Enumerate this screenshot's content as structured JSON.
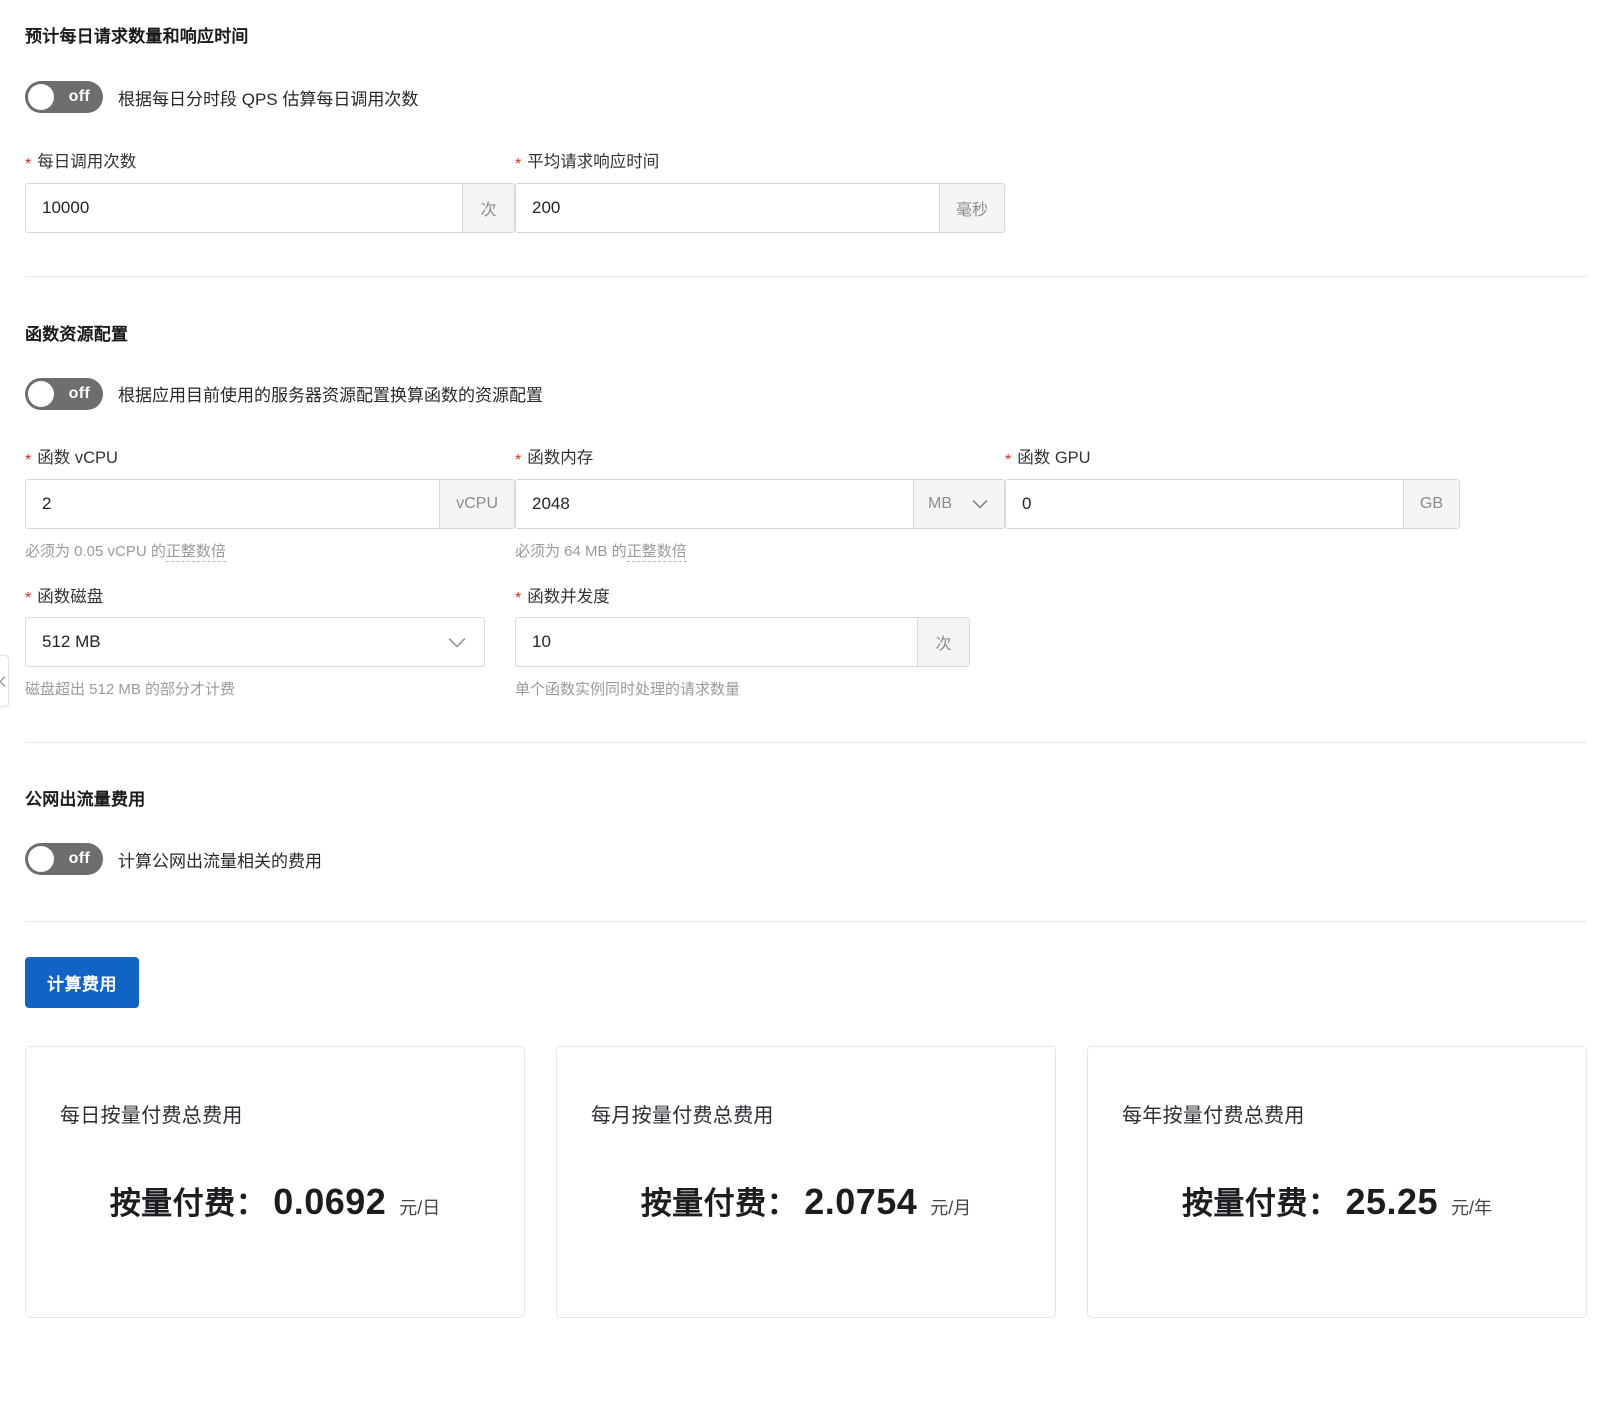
{
  "sections": {
    "requests": {
      "title": "预计每日请求数量和响应时间",
      "toggle": {
        "state": "off",
        "label": "根据每日分时段 QPS 估算每日调用次数"
      },
      "fields": {
        "daily_calls": {
          "label": "每日调用次数",
          "value": "10000",
          "suffix": "次"
        },
        "avg_response": {
          "label": "平均请求响应时间",
          "value": "200",
          "suffix": "毫秒"
        }
      }
    },
    "resources": {
      "title": "函数资源配置",
      "toggle": {
        "state": "off",
        "label": "根据应用目前使用的服务器资源配置换算函数的资源配置"
      },
      "fields": {
        "vcpu": {
          "label": "函数 vCPU",
          "value": "2",
          "suffix": "vCPU",
          "hint_prefix": "必须为 0.05 vCPU 的",
          "hint_link": "正整数倍"
        },
        "memory": {
          "label": "函数内存",
          "value": "2048",
          "suffix": "MB",
          "hint_prefix": "必须为 64 MB 的",
          "hint_link": "正整数倍"
        },
        "gpu": {
          "label": "函数 GPU",
          "value": "0",
          "suffix": "GB"
        },
        "disk": {
          "label": "函数磁盘",
          "value": "512 MB",
          "hint": "磁盘超出 512 MB 的部分才计费"
        },
        "concurrency": {
          "label": "函数并发度",
          "value": "10",
          "suffix": "次",
          "hint": "单个函数实例同时处理的请求数量"
        }
      }
    },
    "traffic": {
      "title": "公网出流量费用",
      "toggle": {
        "state": "off",
        "label": "计算公网出流量相关的费用"
      }
    }
  },
  "actions": {
    "calculate": "计算费用"
  },
  "results": [
    {
      "title": "每日按量付费总费用",
      "label": "按量付费：",
      "value": "0.0692",
      "unit": "元/日"
    },
    {
      "title": "每月按量付费总费用",
      "label": "按量付费：",
      "value": "2.0754",
      "unit": "元/月"
    },
    {
      "title": "每年按量付费总费用",
      "label": "按量付费：",
      "value": "25.25",
      "unit": "元/年"
    }
  ],
  "colors": {
    "primary": "#1164c6",
    "required": "#d93026",
    "toggle_off": "#6e6e6e"
  }
}
